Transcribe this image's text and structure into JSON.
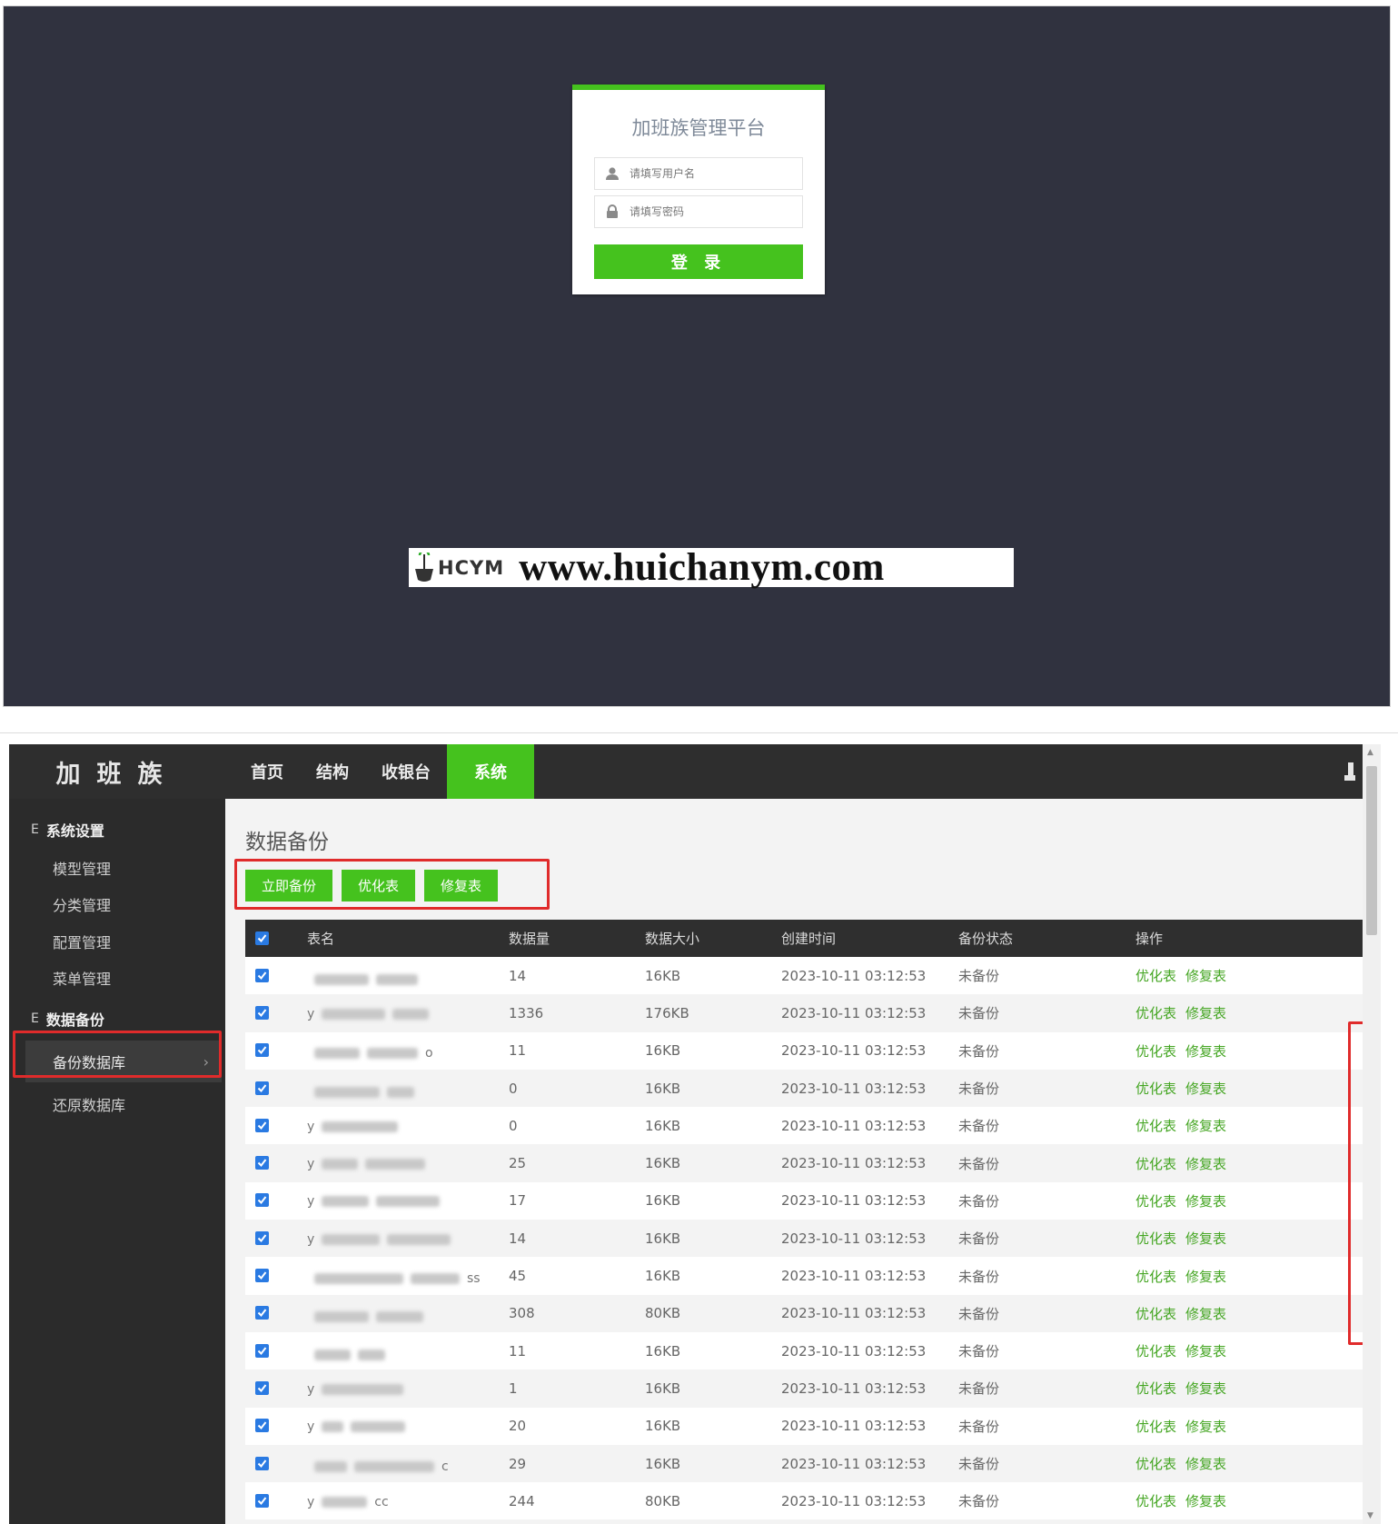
{
  "login": {
    "title": "加班族管理平台",
    "username_placeholder": "请填写用户名",
    "password_placeholder": "请填写密码",
    "login_button": "登 录"
  },
  "watermark": {
    "logo_text": "HCYM",
    "url": "www.huichanym.com"
  },
  "admin": {
    "brand": "加班族",
    "nav": [
      {
        "label": "首页"
      },
      {
        "label": "结构"
      },
      {
        "label": "收银台"
      },
      {
        "label": "系统",
        "active": true
      }
    ],
    "sidebar": {
      "groups": [
        {
          "mark": "E",
          "label": "系统设置",
          "items": [
            "模型管理",
            "分类管理",
            "配置管理",
            "菜单管理"
          ]
        },
        {
          "mark": "E",
          "label": "数据备份",
          "items": [
            "备份数据库",
            "还原数据库"
          ]
        }
      ],
      "active_item": "备份数据库"
    },
    "page_title": "数据备份",
    "toolbar": {
      "backup_now": "立即备份",
      "optimize": "优化表",
      "repair": "修复表"
    },
    "table": {
      "headers": [
        "表名",
        "数据量",
        "数据大小",
        "创建时间",
        "备份状态",
        "操作"
      ],
      "op_optimize": "优化表",
      "op_repair": "修复表",
      "rows": [
        {
          "name_prefix": "",
          "name_suffix": "",
          "count": "14",
          "size": "16KB",
          "created": "2023-10-11 03:12:53",
          "status": "未备份"
        },
        {
          "name_prefix": "y",
          "name_suffix": "",
          "count": "1336",
          "size": "176KB",
          "created": "2023-10-11 03:12:53",
          "status": "未备份"
        },
        {
          "name_prefix": "",
          "name_suffix": "o",
          "count": "11",
          "size": "16KB",
          "created": "2023-10-11 03:12:53",
          "status": "未备份"
        },
        {
          "name_prefix": "",
          "name_suffix": "",
          "count": "0",
          "size": "16KB",
          "created": "2023-10-11 03:12:53",
          "status": "未备份"
        },
        {
          "name_prefix": "y",
          "name_suffix": "",
          "count": "0",
          "size": "16KB",
          "created": "2023-10-11 03:12:53",
          "status": "未备份"
        },
        {
          "name_prefix": "y",
          "name_suffix": "",
          "count": "25",
          "size": "16KB",
          "created": "2023-10-11 03:12:53",
          "status": "未备份"
        },
        {
          "name_prefix": "y",
          "name_suffix": "",
          "count": "17",
          "size": "16KB",
          "created": "2023-10-11 03:12:53",
          "status": "未备份"
        },
        {
          "name_prefix": "y",
          "name_suffix": "",
          "count": "14",
          "size": "16KB",
          "created": "2023-10-11 03:12:53",
          "status": "未备份"
        },
        {
          "name_prefix": "",
          "name_suffix": "ss",
          "count": "45",
          "size": "16KB",
          "created": "2023-10-11 03:12:53",
          "status": "未备份"
        },
        {
          "name_prefix": "",
          "name_suffix": "",
          "count": "308",
          "size": "80KB",
          "created": "2023-10-11 03:12:53",
          "status": "未备份"
        },
        {
          "name_prefix": "",
          "name_suffix": "",
          "count": "11",
          "size": "16KB",
          "created": "2023-10-11 03:12:53",
          "status": "未备份"
        },
        {
          "name_prefix": "y",
          "name_suffix": "",
          "count": "1",
          "size": "16KB",
          "created": "2023-10-11 03:12:53",
          "status": "未备份"
        },
        {
          "name_prefix": "y",
          "name_suffix": "",
          "count": "20",
          "size": "16KB",
          "created": "2023-10-11 03:12:53",
          "status": "未备份"
        },
        {
          "name_prefix": "",
          "name_suffix": "c",
          "count": "29",
          "size": "16KB",
          "created": "2023-10-11 03:12:53",
          "status": "未备份"
        },
        {
          "name_prefix": "y",
          "name_suffix": "cc",
          "count": "244",
          "size": "80KB",
          "created": "2023-10-11 03:12:53",
          "status": "未备份"
        }
      ]
    }
  },
  "colors": {
    "accent_green": "#45c21e",
    "login_background": "#30323f",
    "topbar": "#2e2e2e",
    "sidebar": "#2b2b2b",
    "highlight_red": "#e02b2b",
    "checkbox_blue": "#2a7ae2"
  },
  "icons": {
    "username": "user-icon",
    "password": "lock-icon",
    "header_user": "user-icon",
    "sidebar_chevron": "chevron-right-icon",
    "checkbox": "checkbox-checked-icon"
  }
}
